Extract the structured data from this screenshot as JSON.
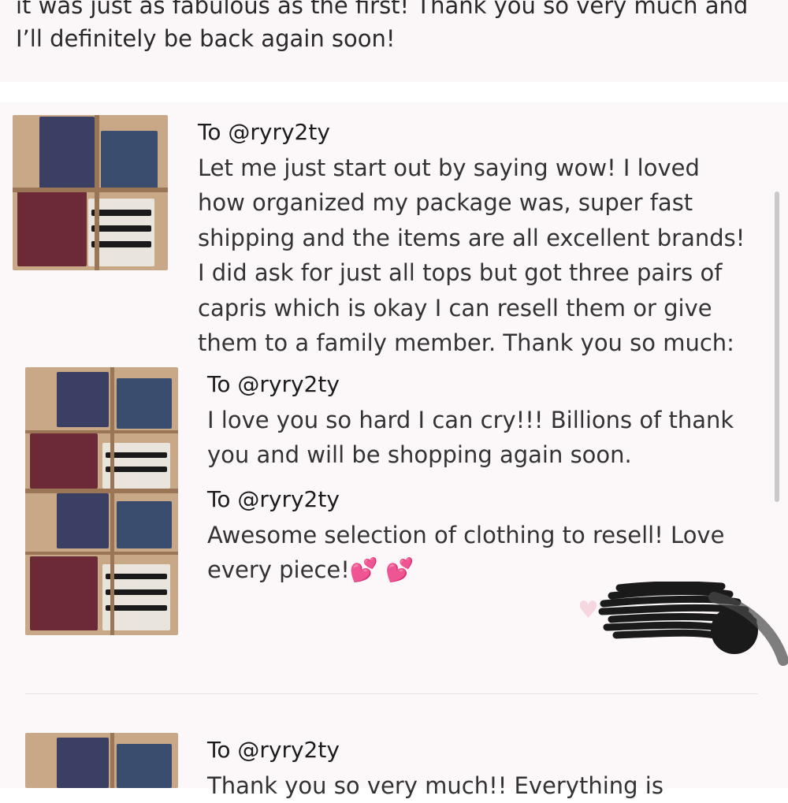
{
  "top_review": {
    "lines": [
      "it was just as fabulous as the first! Thank you so very much and",
      "I’ll definitely be back again soon!"
    ]
  },
  "reviews": [
    {
      "to": "To @ryry2ty",
      "lines": [
        "Let me just start out by saying wow! I loved",
        "how organized my package was, super fast",
        "shipping and the items are all excellent brands!",
        "I did ask for just all tops but got three pairs of",
        "capris which is okay I can resell them or give",
        "them to a family member. Thank you so much:"
      ]
    },
    {
      "to": "To @ryry2ty",
      "lines": [
        "I love you so hard I can cry!!! Billions of thank",
        "you and will be shopping again soon."
      ]
    },
    {
      "to": "To @ryry2ty",
      "lines": [
        "Awesome selection of clothing to resell! Love",
        "every piece!💕 💕"
      ]
    },
    {
      "to": "To @ryry2ty",
      "lines": [
        "Thank you so very much!! Everything is"
      ]
    }
  ],
  "icons": {
    "like": "heart-icon",
    "photo": "package-photo"
  },
  "colors": {
    "background": "#fcf8fa",
    "like_heart": "#f6d6df",
    "emoji_heart": "#e0568f"
  }
}
